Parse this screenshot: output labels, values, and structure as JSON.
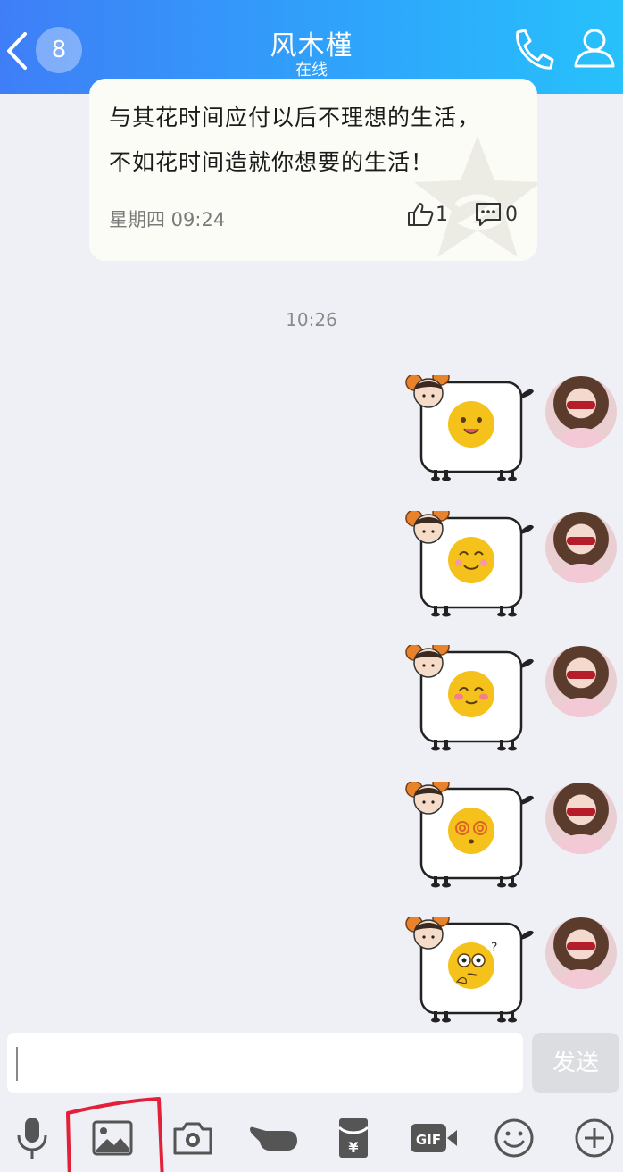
{
  "header": {
    "unread_count": "8",
    "contact_name": "风木槿",
    "status": "在线"
  },
  "card": {
    "line1": "与其花时间应付以后不理想的生活，",
    "line2": "不如花时间造就你想要的生活！",
    "time": "星期四 09:24",
    "likes": "1",
    "comments": "0"
  },
  "timestamp": "10:26",
  "stickers": [
    {
      "face": "tongue-out",
      "face_color": "#f4c21b"
    },
    {
      "face": "smile",
      "face_color": "#f4c21b"
    },
    {
      "face": "blush-smile",
      "face_color": "#f4c21b"
    },
    {
      "face": "dizzy",
      "face_color": "#f4c21b"
    },
    {
      "face": "confused",
      "face_color": "#f4c21b"
    }
  ],
  "input": {
    "value": ""
  },
  "send_label": "发送",
  "toolbar_icons": [
    "microphone-icon",
    "image-icon",
    "camera-icon",
    "poke-icon",
    "red-packet-icon",
    "gif-icon",
    "emoji-icon",
    "plus-icon"
  ],
  "colors": {
    "header_start": "#3f7ef7",
    "header_end": "#27c1fb",
    "annotation_red": "#e3203a"
  }
}
